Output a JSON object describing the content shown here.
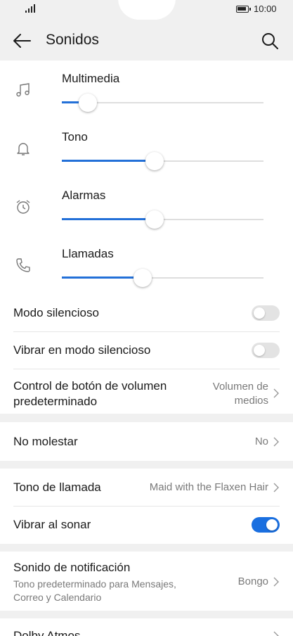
{
  "status_bar": {
    "time": "10:00"
  },
  "header": {
    "title": "Sonidos"
  },
  "volume": [
    {
      "label": "Multimedia",
      "level": 0.13,
      "icon": "music-note-icon"
    },
    {
      "label": "Tono",
      "level": 0.46,
      "icon": "bell-icon"
    },
    {
      "label": "Alarmas",
      "level": 0.46,
      "icon": "alarm-clock-icon"
    },
    {
      "label": "Llamadas",
      "level": 0.4,
      "icon": "phone-icon"
    }
  ],
  "silent": {
    "silent_mode": {
      "label": "Modo silencioso",
      "on": false
    },
    "vibrate_silent": {
      "label": "Vibrar en modo silencioso",
      "on": false
    },
    "volume_button": {
      "label_line1": "Control de botón de volumen",
      "label_line2": "predeterminado",
      "value_line1": "Volumen de",
      "value_line2": "medios"
    }
  },
  "dnd": {
    "label": "No molestar",
    "value": "No"
  },
  "ringtone": {
    "label": "Tono de llamada",
    "value": "Maid with the Flaxen Hair"
  },
  "vibrate_ring": {
    "label": "Vibrar al sonar",
    "on": true
  },
  "notification": {
    "label": "Sonido de notificación",
    "sub_line1": "Tono predeterminado para Mensajes,",
    "sub_line2": "Correo y Calendario",
    "value": "Bongo"
  },
  "dolby": {
    "label": "Dolby Atmos"
  },
  "colors": {
    "accent": "#1a6fe0",
    "slider_fill": "#2370d8"
  }
}
